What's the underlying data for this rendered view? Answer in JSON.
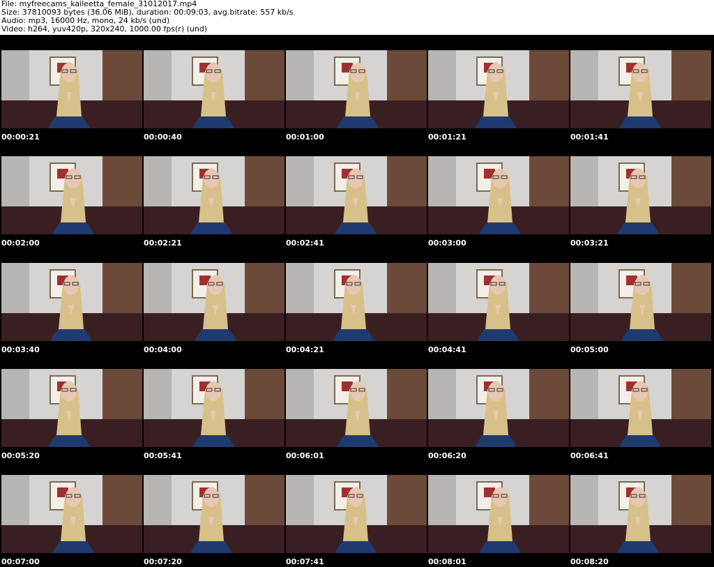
{
  "header": {
    "file": "File: myfreecams_kaileetta_female_31012017.mp4",
    "size": "Size: 37810093 bytes (36.06 MiB), duration: 00:09:03, avg.bitrate: 557 kb/s",
    "audio": "Audio: mp3, 16000 Hz, mono, 24 kb/s (und)",
    "video": "Video: h264, yuv420p, 320x240, 1000.00 fps(r) (und)"
  },
  "thumbnails": [
    {
      "time": "00:00:21"
    },
    {
      "time": "00:00:40"
    },
    {
      "time": "00:01:00"
    },
    {
      "time": "00:01:21"
    },
    {
      "time": "00:01:41"
    },
    {
      "time": "00:02:00"
    },
    {
      "time": "00:02:21"
    },
    {
      "time": "00:02:41"
    },
    {
      "time": "00:03:00"
    },
    {
      "time": "00:03:21"
    },
    {
      "time": "00:03:40"
    },
    {
      "time": "00:04:00"
    },
    {
      "time": "00:04:21"
    },
    {
      "time": "00:04:41"
    },
    {
      "time": "00:05:00"
    },
    {
      "time": "00:05:20"
    },
    {
      "time": "00:05:41"
    },
    {
      "time": "00:06:01"
    },
    {
      "time": "00:06:20"
    },
    {
      "time": "00:06:41"
    },
    {
      "time": "00:07:00"
    },
    {
      "time": "00:07:20"
    },
    {
      "time": "00:07:41"
    },
    {
      "time": "00:08:01"
    },
    {
      "time": "00:08:20"
    }
  ],
  "colors": {
    "background": "#000000",
    "header_bg": "#ffffff",
    "timestamp": "#ffffff",
    "wall": "#d6d4d2",
    "curtain": "#6b4a3a",
    "sofa": "#3a1f22",
    "jacket": "#1f3a6e",
    "hair": "#d8c08a",
    "skin": "#e8c7b2"
  }
}
